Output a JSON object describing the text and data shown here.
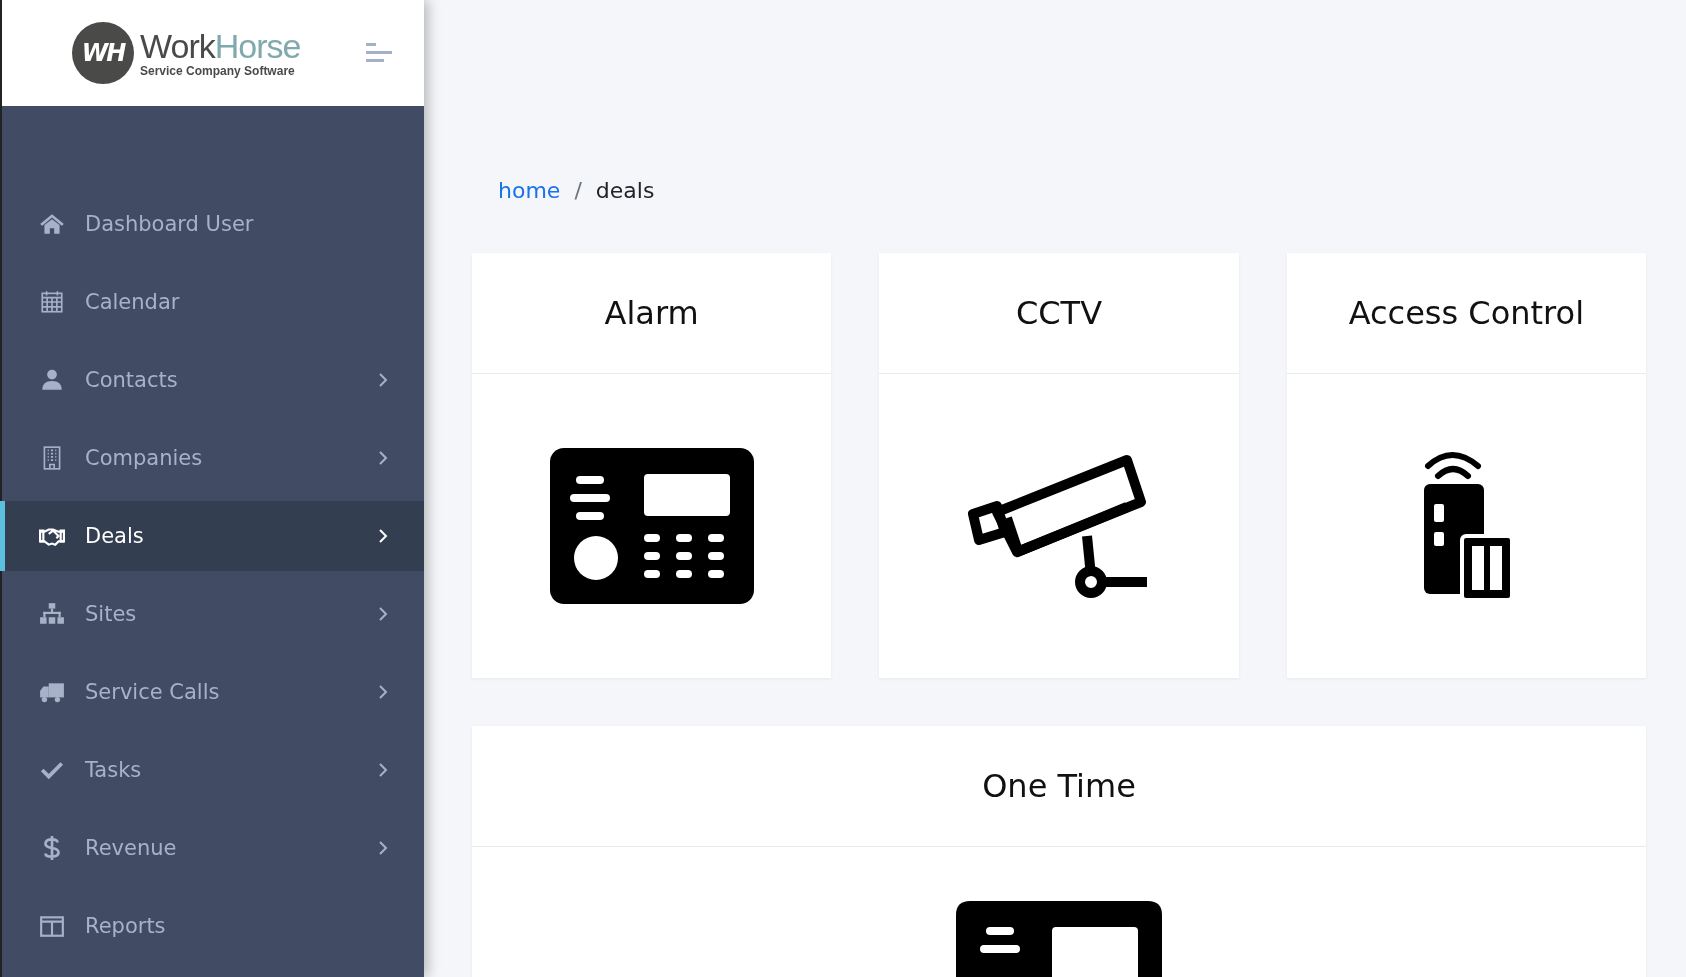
{
  "logo": {
    "monogram": "WH",
    "name_main": "Work",
    "name_accent": "Horse",
    "tagline": "Service Company Software"
  },
  "sidebar": {
    "items": [
      {
        "label": "Dashboard User",
        "selected": false,
        "has_submenu": false
      },
      {
        "label": "Calendar",
        "selected": false,
        "has_submenu": false
      },
      {
        "label": "Contacts",
        "selected": false,
        "has_submenu": true
      },
      {
        "label": "Companies",
        "selected": false,
        "has_submenu": true
      },
      {
        "label": "Deals",
        "selected": true,
        "has_submenu": true
      },
      {
        "label": "Sites",
        "selected": false,
        "has_submenu": true
      },
      {
        "label": "Service Calls",
        "selected": false,
        "has_submenu": true
      },
      {
        "label": "Tasks",
        "selected": false,
        "has_submenu": true
      },
      {
        "label": "Revenue",
        "selected": false,
        "has_submenu": true
      },
      {
        "label": "Reports",
        "selected": false,
        "has_submenu": false
      }
    ]
  },
  "breadcrumb": {
    "link": "home",
    "separator": "/",
    "current": "deals"
  },
  "cards": [
    {
      "title": "Alarm"
    },
    {
      "title": "CCTV"
    },
    {
      "title": "Access Control"
    },
    {
      "title": "One Time"
    }
  ]
}
